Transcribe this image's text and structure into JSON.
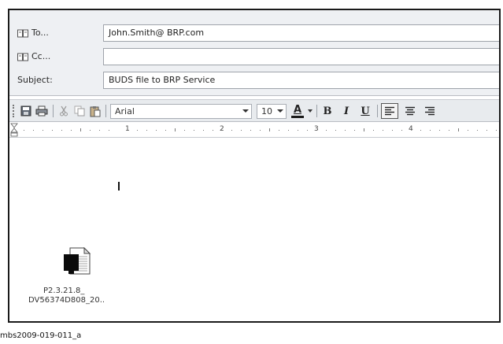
{
  "header": {
    "to_label": "To...",
    "to_value": "John.Smith@ BRP.com",
    "cc_label": "Cc...",
    "cc_value": "",
    "subject_label": "Subject:",
    "subject_value": "BUDS file to BRP Service"
  },
  "toolbar": {
    "font_name": "Arial",
    "font_size": "10",
    "bold_label": "B",
    "italic_label": "I",
    "underline_label": "U",
    "font_color_label": "A"
  },
  "ruler": {
    "numbers": [
      "1",
      "2",
      "3",
      "4"
    ]
  },
  "attachment": {
    "name_line1": "P2.3.21.8_",
    "name_line2": "DV56374D808_20.."
  },
  "caption": "mbs2009-019-011_a",
  "colors": {
    "header_bg": "#eef0f3",
    "toolbar_bg": "#e8ebee",
    "font_color_bar": "#1a1a1a"
  }
}
